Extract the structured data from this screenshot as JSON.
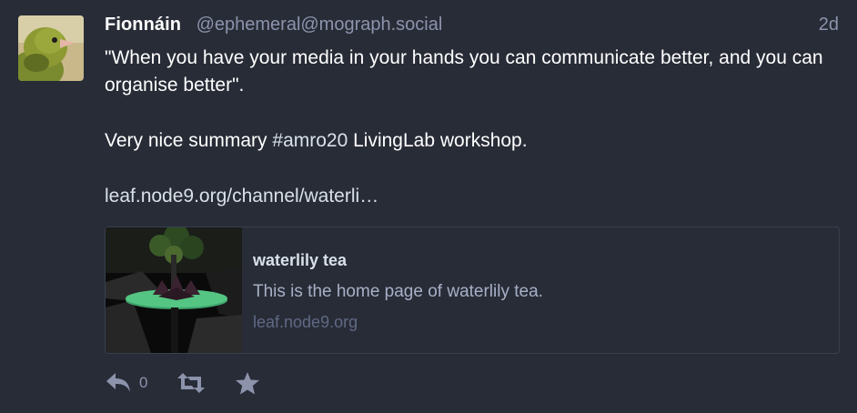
{
  "status": {
    "display_name": "Fionnáin",
    "account": "@ephemeral@mograph.social",
    "relative_time": "2d",
    "content": {
      "paragraph_1": "\"When you have your media in your hands you can communicate better, and you can organise better\".",
      "paragraph_2_before": "Very nice summary ",
      "hashtag": "#amro20",
      "paragraph_2_after": " LivingLab workshop.",
      "link": "leaf.node9.org/channel/waterli…"
    },
    "card": {
      "title": "waterlily tea",
      "description": "This is the home page of waterlily tea.",
      "host": "leaf.node9.org"
    },
    "actions": {
      "reply_count": "0",
      "reply_icon": "reply-icon",
      "reblog_icon": "boost-icon",
      "favourite_icon": "star-icon"
    }
  },
  "colors": {
    "background": "#282c37",
    "text": "#ffffff",
    "muted": "#8c93ab",
    "link": "#d9e1e8",
    "icon": "#8c93ab",
    "card_border": "#393f4f"
  }
}
